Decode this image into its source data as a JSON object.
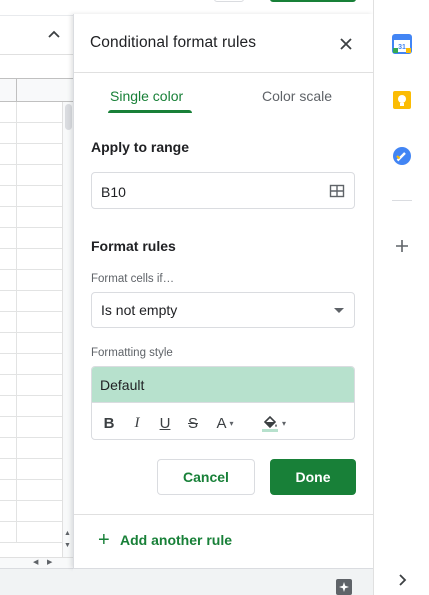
{
  "panel": {
    "title": "Conditional format rules",
    "tabs": [
      {
        "label": "Single color",
        "active": true
      },
      {
        "label": "Color scale",
        "active": false
      }
    ],
    "apply_to_range": {
      "label": "Apply to range",
      "value": "B10"
    },
    "format_rules": {
      "label": "Format rules",
      "condition_label": "Format cells if…",
      "condition_value": "Is not empty",
      "style_label": "Formatting style",
      "style_preview": "Default",
      "style_fill_color": "#b7e1cd"
    },
    "toolbar": {
      "bold": "B",
      "italic": "I",
      "underline": "U",
      "strikethrough": "S",
      "text_color": "A"
    },
    "buttons": {
      "cancel": "Cancel",
      "done": "Done"
    },
    "add_rule": "Add another rule"
  },
  "colors": {
    "accent": "#188038",
    "highlight": "#b7e1cd"
  },
  "rail": {
    "icons": [
      "calendar-icon",
      "keep-icon",
      "tasks-icon",
      "add-icon",
      "expand-icon"
    ]
  }
}
